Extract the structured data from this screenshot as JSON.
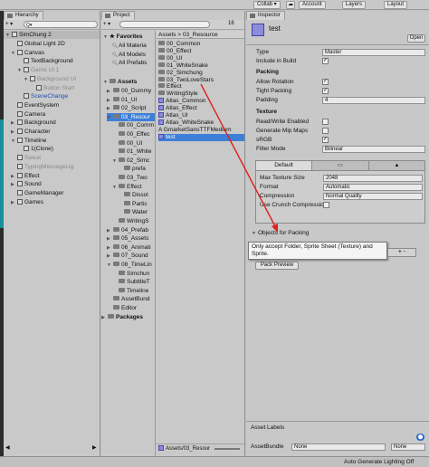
{
  "toolbar": {
    "collab": "Collab ▾",
    "account": "Account",
    "layers": "Layers",
    "layout": "Layout"
  },
  "hierarchy": {
    "tab": "Hierarchy",
    "create": "+ ▾",
    "search_prefix": "Q▾",
    "scene": "SimChung 2",
    "items": [
      {
        "label": "Global Light 2D",
        "indent": 2,
        "arrow": "",
        "style": ""
      },
      {
        "label": "Canvas",
        "indent": 2,
        "arrow": "▼",
        "style": ""
      },
      {
        "label": "TextBackground",
        "indent": 3,
        "arrow": "",
        "style": ""
      },
      {
        "label": "Game UI 1",
        "indent": 3,
        "arrow": "▼",
        "style": "dim"
      },
      {
        "label": "Background UI",
        "indent": 4,
        "arrow": "▼",
        "style": "dim"
      },
      {
        "label": "Button Start",
        "indent": 5,
        "arrow": "",
        "style": "dim"
      },
      {
        "label": "SceneChange",
        "indent": 3,
        "arrow": "",
        "style": "blue"
      },
      {
        "label": "EventSystem",
        "indent": 2,
        "arrow": "",
        "style": ""
      },
      {
        "label": "Camera",
        "indent": 2,
        "arrow": "",
        "style": ""
      },
      {
        "label": "Background",
        "indent": 2,
        "arrow": "▶",
        "style": ""
      },
      {
        "label": "Character",
        "indent": 2,
        "arrow": "▶",
        "style": ""
      },
      {
        "label": "Timeline",
        "indent": 2,
        "arrow": "▼",
        "style": ""
      },
      {
        "label": "1(Clone)",
        "indent": 3,
        "arrow": "",
        "style": ""
      },
      {
        "label": "Sweat",
        "indent": 2,
        "arrow": "",
        "style": "dim"
      },
      {
        "label": "TypingMessageLig",
        "indent": 2,
        "arrow": "",
        "style": "dim"
      },
      {
        "label": "Effect",
        "indent": 2,
        "arrow": "▶",
        "style": ""
      },
      {
        "label": "Sound",
        "indent": 2,
        "arrow": "▶",
        "style": ""
      },
      {
        "label": "GameManager",
        "indent": 2,
        "arrow": "",
        "style": ""
      },
      {
        "label": "Games",
        "indent": 2,
        "arrow": "▶",
        "style": ""
      }
    ]
  },
  "project": {
    "tab": "Project",
    "count": "16",
    "breadcrumb": "Assets > 03_Resource",
    "favorites_label": "Favorites",
    "favorites": [
      "All Materia",
      "All Models",
      "All Prefabs"
    ],
    "assets_label": "Assets",
    "tree": [
      {
        "label": "00_Dummy",
        "indent": 1,
        "arrow": "▶",
        "sel": false
      },
      {
        "label": "01_UI",
        "indent": 1,
        "arrow": "▶",
        "sel": false
      },
      {
        "label": "02_Script",
        "indent": 1,
        "arrow": "▶",
        "sel": false
      },
      {
        "label": "03_Resour",
        "indent": 1,
        "arrow": "▼",
        "sel": true
      },
      {
        "label": "00_Comm",
        "indent": 2,
        "arrow": "",
        "sel": false
      },
      {
        "label": "00_Effec",
        "indent": 2,
        "arrow": "",
        "sel": false
      },
      {
        "label": "00_UI",
        "indent": 2,
        "arrow": "",
        "sel": false
      },
      {
        "label": "01_White",
        "indent": 2,
        "arrow": "",
        "sel": false
      },
      {
        "label": "02_Simc",
        "indent": 2,
        "arrow": "▼",
        "sel": false
      },
      {
        "label": "prefa",
        "indent": 3,
        "arrow": "",
        "sel": false
      },
      {
        "label": "03_Two",
        "indent": 2,
        "arrow": "",
        "sel": false
      },
      {
        "label": "Effect",
        "indent": 2,
        "arrow": "▼",
        "sel": false
      },
      {
        "label": "Dissol",
        "indent": 3,
        "arrow": "",
        "sel": false
      },
      {
        "label": "Partic",
        "indent": 3,
        "arrow": "",
        "sel": false
      },
      {
        "label": "Water",
        "indent": 3,
        "arrow": "",
        "sel": false
      },
      {
        "label": "WritingS",
        "indent": 2,
        "arrow": "",
        "sel": false
      },
      {
        "label": "04_Prefab",
        "indent": 1,
        "arrow": "▶",
        "sel": false
      },
      {
        "label": "05_Assets",
        "indent": 1,
        "arrow": "▶",
        "sel": false
      },
      {
        "label": "06_Animati",
        "indent": 1,
        "arrow": "▶",
        "sel": false
      },
      {
        "label": "07_Sound",
        "indent": 1,
        "arrow": "▶",
        "sel": false
      },
      {
        "label": "08_TimeLin",
        "indent": 1,
        "arrow": "▼",
        "sel": false
      },
      {
        "label": "Simchun",
        "indent": 2,
        "arrow": "",
        "sel": false
      },
      {
        "label": "SubtitleT",
        "indent": 2,
        "arrow": "",
        "sel": false
      },
      {
        "label": "Timeline",
        "indent": 2,
        "arrow": "",
        "sel": false
      },
      {
        "label": "AssetBund",
        "indent": 1,
        "arrow": "",
        "sel": false
      },
      {
        "label": "Editor",
        "indent": 1,
        "arrow": "",
        "sel": false
      },
      {
        "label": "Packages",
        "indent": 0,
        "arrow": "▶",
        "sel": false
      }
    ],
    "files": [
      {
        "label": "00_Common",
        "kind": "folder",
        "sel": false
      },
      {
        "label": "00_Effect",
        "kind": "folder",
        "sel": false
      },
      {
        "label": "00_UI",
        "kind": "folder",
        "sel": false
      },
      {
        "label": "01_WhiteSnake",
        "kind": "folder",
        "sel": false
      },
      {
        "label": "02_Simchung",
        "kind": "folder",
        "sel": false
      },
      {
        "label": "03_TwoLoveStars",
        "kind": "folder",
        "sel": false
      },
      {
        "label": "Effect",
        "kind": "folder",
        "sel": false
      },
      {
        "label": "WritingStyle",
        "kind": "folder",
        "sel": false
      },
      {
        "label": "Atlas_Common",
        "kind": "atlas",
        "sel": false
      },
      {
        "label": "Atlas_Effect",
        "kind": "atlas",
        "sel": false
      },
      {
        "label": "Atlas_UI",
        "kind": "atlas",
        "sel": false
      },
      {
        "label": "Atlas_WhiteSnake",
        "kind": "atlas",
        "sel": false
      },
      {
        "label": "GmarketSansTTFMedium",
        "kind": "font",
        "sel": false
      },
      {
        "label": "test",
        "kind": "atlas",
        "sel": true
      }
    ],
    "footer_path": "Assets/03_Resour"
  },
  "inspector": {
    "tab": "Inspector",
    "asset_name": "test",
    "open_button": "Open",
    "type_label": "Type",
    "type_value": "Master",
    "include_label": "Include in Build",
    "packing_header": "Packing",
    "allow_rotation": "Allow Rotation",
    "tight_packing": "Tight Packing",
    "padding_label": "Padding",
    "padding_value": "4",
    "texture_header": "Texture",
    "readwrite": "Read/Write Enabled",
    "mipmaps": "Generate Mip Maps",
    "srgb": "sRGB",
    "filter_label": "Filter Mode",
    "filter_value": "Bilinear",
    "platform_default": "Default",
    "max_size_label": "Max Texture Size",
    "max_size_value": "2048",
    "format_label": "Format",
    "format_value": "Automatic",
    "compression_label": "Compression",
    "compression_value": "Normal Quality",
    "crunch_label": "Use Crunch Compressic",
    "objects_header": "Objects for Packing",
    "tooltip": "Only accept Folder, Sprite Sheet (Texture) and Sprite.",
    "add_remove": "+ -",
    "pack_preview": "Pack Preview",
    "asset_labels": "Asset Labels",
    "assetbundle_label": "AssetBundle",
    "assetbundle_value": "None",
    "assetbundle_variant": "None"
  },
  "status": {
    "text": "Auto Generate Lighting Off"
  },
  "colors": {
    "selection": "#3d7fd8",
    "arrow": "#e02020"
  }
}
